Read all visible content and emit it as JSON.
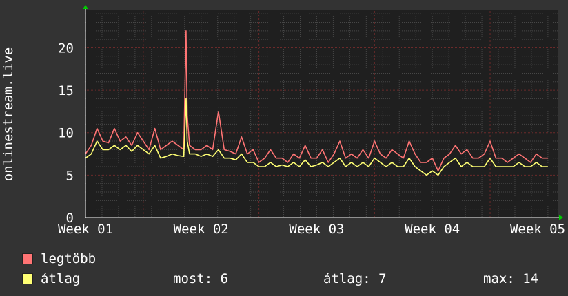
{
  "chart_data": {
    "type": "line",
    "ylabel": "onlinestream.live",
    "ylim": [
      0,
      24.5
    ],
    "yticks": [
      0,
      5,
      10,
      15,
      20
    ],
    "xticks": [
      {
        "label": "Week 01",
        "x": 0
      },
      {
        "label": "Week 02",
        "x": 1
      },
      {
        "label": "Week 03",
        "x": 2
      },
      {
        "label": "Week 04",
        "x": 3
      },
      {
        "label": "Week 05",
        "x": 4
      }
    ],
    "xlim": [
      0,
      4.09
    ],
    "grid": true,
    "series": [
      {
        "name": "legtöbb",
        "color": "#ff7474",
        "x": [
          0,
          0.05,
          0.1,
          0.15,
          0.2,
          0.25,
          0.3,
          0.35,
          0.4,
          0.45,
          0.5,
          0.55,
          0.6,
          0.65,
          0.7,
          0.75,
          0.8,
          0.85,
          0.87,
          0.88,
          0.9,
          0.95,
          1.0,
          1.05,
          1.1,
          1.15,
          1.2,
          1.25,
          1.3,
          1.35,
          1.4,
          1.45,
          1.5,
          1.55,
          1.6,
          1.65,
          1.7,
          1.75,
          1.8,
          1.85,
          1.9,
          1.95,
          2.0,
          2.05,
          2.1,
          2.15,
          2.2,
          2.25,
          2.3,
          2.35,
          2.4,
          2.45,
          2.5,
          2.55,
          2.6,
          2.65,
          2.7,
          2.75,
          2.8,
          2.85,
          2.9,
          2.95,
          3.0,
          3.05,
          3.1,
          3.15,
          3.2,
          3.25,
          3.3,
          3.35,
          3.4,
          3.45,
          3.5,
          3.55,
          3.6,
          3.65,
          3.7,
          3.75,
          3.8,
          3.85,
          3.9,
          3.95,
          4.0
        ],
        "values": [
          7.5,
          8.5,
          10.5,
          9.0,
          8.8,
          10.5,
          9.0,
          9.5,
          8.5,
          10.0,
          9.0,
          8.0,
          10.5,
          8.0,
          8.5,
          9.0,
          8.5,
          8.0,
          22.0,
          12.0,
          8.5,
          8.0,
          8.0,
          8.5,
          8.0,
          12.5,
          8.0,
          7.8,
          7.5,
          9.5,
          7.5,
          8.0,
          6.5,
          7.0,
          8.0,
          7.0,
          7.0,
          6.5,
          7.5,
          7.0,
          8.5,
          7.0,
          7.0,
          8.0,
          6.5,
          7.5,
          9.0,
          7.0,
          7.5,
          7.0,
          8.0,
          7.0,
          9.0,
          7.5,
          7.0,
          8.0,
          7.5,
          7.0,
          9.0,
          7.5,
          6.5,
          6.5,
          7.0,
          5.5,
          7.0,
          7.5,
          8.5,
          7.5,
          8.0,
          7.0,
          7.0,
          7.5,
          9.0,
          7.0,
          7.0,
          6.5,
          7.0,
          7.5,
          7.0,
          6.5,
          7.5,
          7.0,
          7.0
        ]
      },
      {
        "name": "átlag",
        "color": "#ffff74",
        "x": [
          0,
          0.05,
          0.1,
          0.15,
          0.2,
          0.25,
          0.3,
          0.35,
          0.4,
          0.45,
          0.5,
          0.55,
          0.6,
          0.65,
          0.7,
          0.75,
          0.8,
          0.85,
          0.87,
          0.88,
          0.9,
          0.95,
          1.0,
          1.05,
          1.1,
          1.15,
          1.2,
          1.25,
          1.3,
          1.35,
          1.4,
          1.45,
          1.5,
          1.55,
          1.6,
          1.65,
          1.7,
          1.75,
          1.8,
          1.85,
          1.9,
          1.95,
          2.0,
          2.05,
          2.1,
          2.15,
          2.2,
          2.25,
          2.3,
          2.35,
          2.4,
          2.45,
          2.5,
          2.55,
          2.6,
          2.65,
          2.7,
          2.75,
          2.8,
          2.85,
          2.9,
          2.95,
          3.0,
          3.05,
          3.1,
          3.15,
          3.2,
          3.25,
          3.3,
          3.35,
          3.4,
          3.45,
          3.5,
          3.55,
          3.6,
          3.65,
          3.7,
          3.75,
          3.8,
          3.85,
          3.9,
          3.95,
          4.0
        ],
        "values": [
          7.0,
          7.5,
          9.0,
          8.0,
          8.0,
          8.5,
          8.0,
          8.5,
          7.8,
          8.5,
          8.0,
          7.5,
          8.5,
          7.0,
          7.2,
          7.5,
          7.3,
          7.2,
          14.0,
          9.0,
          7.5,
          7.5,
          7.2,
          7.5,
          7.2,
          8.0,
          7.0,
          7.0,
          6.8,
          7.5,
          6.5,
          6.5,
          6.0,
          6.0,
          6.5,
          6.0,
          6.2,
          6.0,
          6.5,
          6.0,
          6.8,
          6.0,
          6.2,
          6.5,
          6.0,
          6.5,
          7.0,
          6.0,
          6.5,
          6.0,
          6.5,
          6.0,
          7.0,
          6.5,
          6.0,
          6.5,
          6.0,
          6.0,
          7.0,
          6.0,
          5.5,
          5.0,
          5.5,
          5.0,
          6.0,
          6.5,
          7.0,
          6.0,
          6.5,
          6.0,
          6.0,
          6.0,
          7.0,
          6.0,
          6.0,
          6.0,
          6.0,
          6.5,
          6.0,
          6.0,
          6.5,
          6.0,
          6.0
        ]
      }
    ]
  },
  "legend": {
    "max_label": "legtöbb",
    "avg_label": "átlag",
    "stat_cur": "most: 6",
    "stat_avg": "átlag: 7",
    "stat_max": "max: 14"
  },
  "colors": {
    "background": "#333333",
    "plot_area": "#1f1f1f",
    "grid_minor": "#4a4a4a",
    "grid_major": "#6b2a2a",
    "axis": "#ffffff",
    "arrow": "#00cc00"
  }
}
